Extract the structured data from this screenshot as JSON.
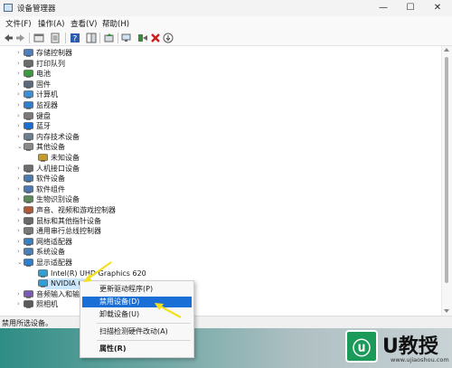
{
  "window": {
    "title": "设备管理器",
    "min_glyph": "—",
    "max_glyph": "☐",
    "close_glyph": "✕"
  },
  "menu": [
    "文件(F)",
    "操作(A)",
    "查看(V)",
    "帮助(H)"
  ],
  "tree": [
    {
      "label": "存储控制器",
      "icon": "storage-controller-icon",
      "expanded": false
    },
    {
      "label": "打印队列",
      "icon": "printer-icon",
      "expanded": false
    },
    {
      "label": "电池",
      "icon": "battery-icon",
      "expanded": false
    },
    {
      "label": "固件",
      "icon": "firmware-icon",
      "expanded": false
    },
    {
      "label": "计算机",
      "icon": "computer-icon",
      "expanded": false
    },
    {
      "label": "监视器",
      "icon": "monitor-icon",
      "expanded": false
    },
    {
      "label": "键盘",
      "icon": "keyboard-icon",
      "expanded": false
    },
    {
      "label": "蓝牙",
      "icon": "bluetooth-icon",
      "expanded": false
    },
    {
      "label": "内存技术设备",
      "icon": "memory-icon",
      "expanded": false
    },
    {
      "label": "其他设备",
      "icon": "other-devices-icon",
      "expanded": true
    },
    {
      "label": "未知设备",
      "icon": "unknown-device-icon",
      "child": true
    },
    {
      "label": "人机接口设备",
      "icon": "hid-icon",
      "expanded": false
    },
    {
      "label": "软件设备",
      "icon": "software-device-icon",
      "expanded": false
    },
    {
      "label": "软件组件",
      "icon": "software-component-icon",
      "expanded": false
    },
    {
      "label": "生物识别设备",
      "icon": "biometric-icon",
      "expanded": false
    },
    {
      "label": "声音、视频和游戏控制器",
      "icon": "sound-icon",
      "expanded": false
    },
    {
      "label": "鼠标和其他指针设备",
      "icon": "mouse-icon",
      "expanded": false
    },
    {
      "label": "通用串行总线控制器",
      "icon": "usb-icon",
      "expanded": false
    },
    {
      "label": "网络适配器",
      "icon": "network-icon",
      "expanded": false
    },
    {
      "label": "系统设备",
      "icon": "system-icon",
      "expanded": false
    },
    {
      "label": "显示适配器",
      "icon": "display-adapter-icon",
      "expanded": true
    },
    {
      "label": "Intel(R) UHD Graphics 620",
      "icon": "gpu-icon",
      "child": true
    },
    {
      "label": "NVIDIA G",
      "icon": "gpu-icon",
      "child": true,
      "selected": true
    },
    {
      "label": "音频输入和输",
      "icon": "audio-icon",
      "expanded": false
    },
    {
      "label": "照相机",
      "icon": "camera-icon",
      "expanded": false
    }
  ],
  "context_menu": [
    {
      "label": "更新驱动程序(P)",
      "highlight": false
    },
    {
      "label": "禁用设备(D)",
      "highlight": true
    },
    {
      "label": "卸载设备(U)",
      "highlight": false
    },
    {
      "label": "扫描检测硬件改动(A)",
      "highlight": false
    },
    {
      "label": "属性(R)",
      "highlight": false,
      "bold": true
    }
  ],
  "status": "禁用所选设备。",
  "watermark": {
    "glyph": "ⓤ",
    "brand": "U教授",
    "url": "www.ujiaoshou.com"
  },
  "colors": {
    "highlight": "#1a6fd6",
    "selection": "#cce8ff",
    "arrow": "#f5e11a"
  }
}
